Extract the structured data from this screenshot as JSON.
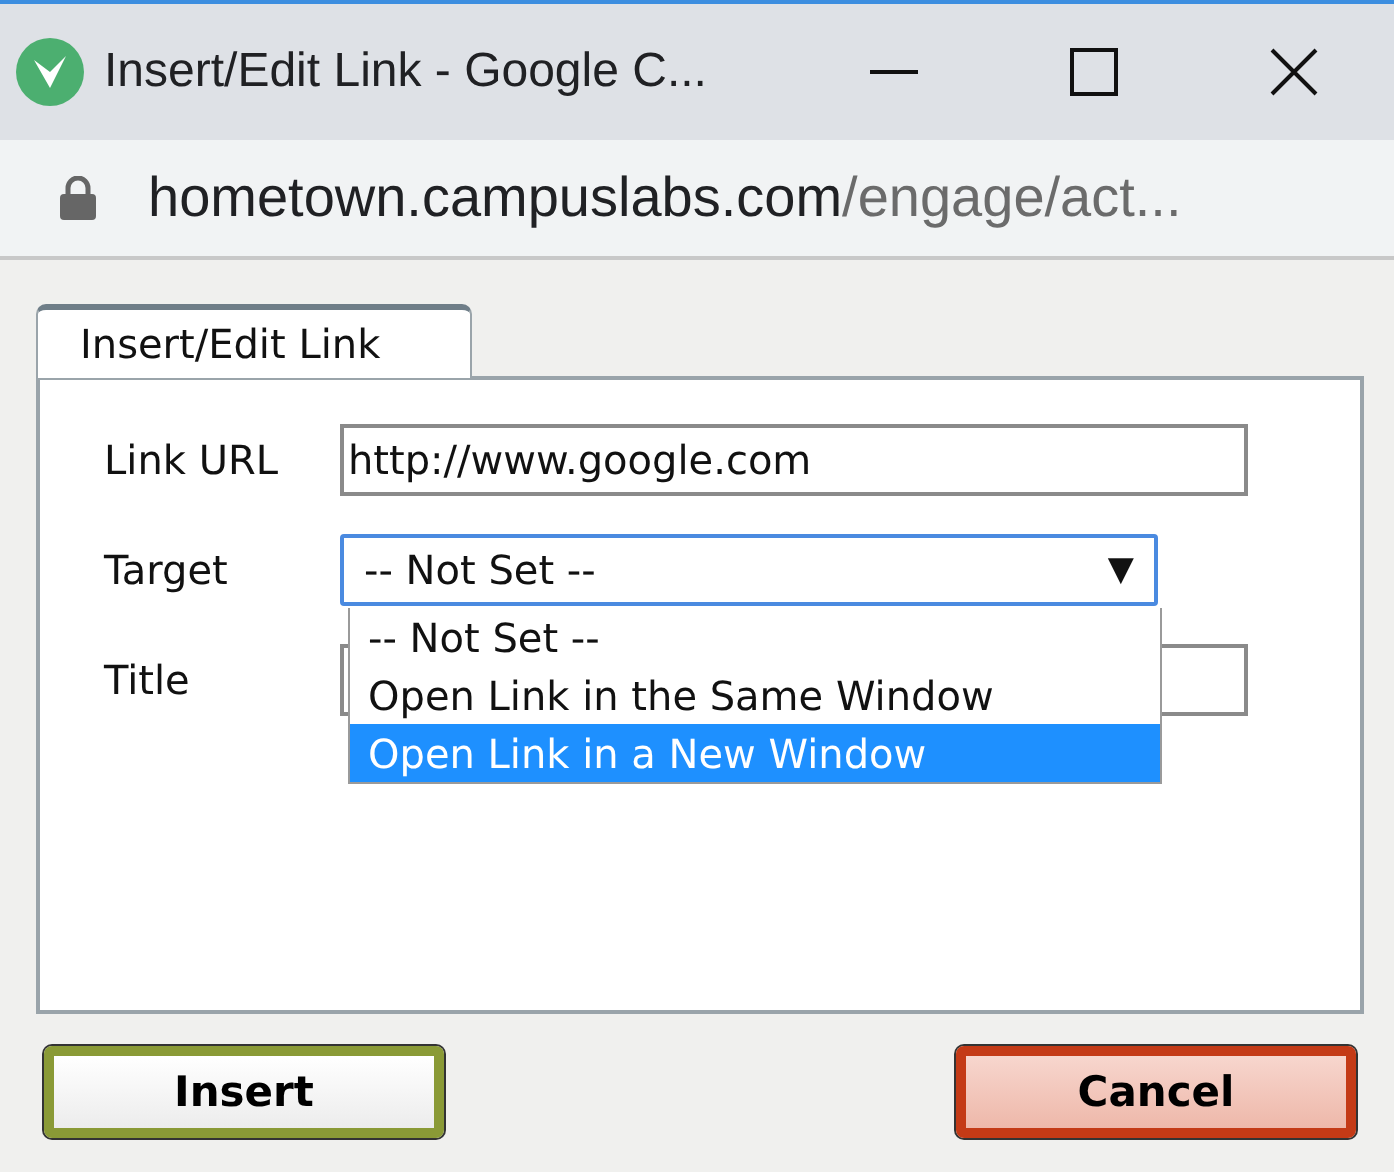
{
  "window": {
    "title": "Insert/Edit Link - Google C..."
  },
  "address": {
    "host": "hometown.campuslabs.com",
    "path": "/engage/act..."
  },
  "tabs": [
    {
      "label": "Insert/Edit Link",
      "selected": true
    }
  ],
  "link_url": {
    "label": "Link URL",
    "value": "http://www.google.com"
  },
  "target": {
    "label": "Target",
    "value": "-- Not Set --",
    "arrow": "▼",
    "expanded": true,
    "options": [
      {
        "label": "-- Not Set --",
        "highlighted": false
      },
      {
        "label": "Open Link in the Same Window",
        "highlighted": false
      },
      {
        "label": "Open Link in a New Window",
        "highlighted": true
      }
    ]
  },
  "title_field": {
    "label": "Title"
  },
  "buttons": [
    {
      "label": "Insert",
      "kind": "primary"
    },
    {
      "label": "Cancel",
      "kind": "cancel"
    }
  ]
}
